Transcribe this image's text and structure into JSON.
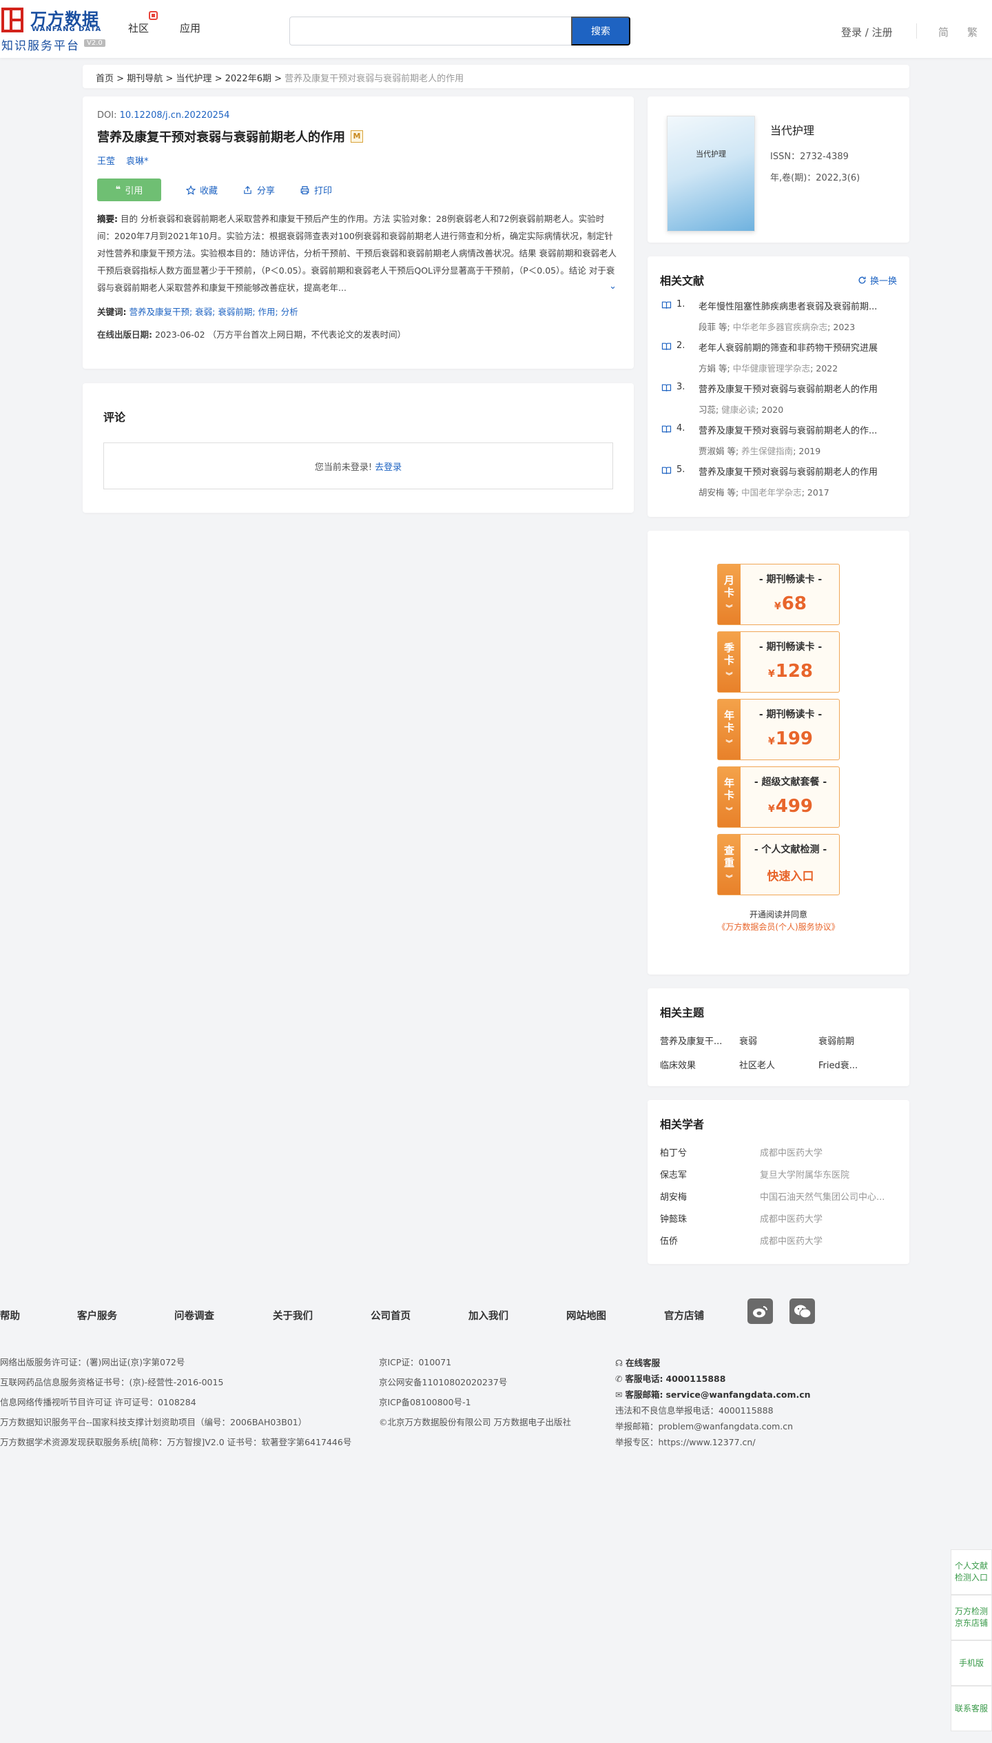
{
  "header": {
    "logo_cn": "万方数据",
    "logo_en": "WANFANG DATA",
    "logo_sub": "知识服务平台",
    "logo_ver": "V2.0",
    "nav": [
      "社区",
      "应用"
    ],
    "search_placeholder": "",
    "search_btn": "搜索",
    "login": "登录 / 注册",
    "lang_simplified": "简",
    "lang_traditional": "繁"
  },
  "breadcrumb": {
    "items": [
      "首页",
      "期刊导航",
      "当代护理",
      "2022年6期"
    ],
    "sep": ">",
    "current": "营养及康复干预对衰弱与衰弱前期老人的作用"
  },
  "article": {
    "doi_label": "DOI:",
    "doi": "10.12208/j.cn.20220254",
    "title": "营养及康复干预对衰弱与衰弱前期老人的作用",
    "m_badge": "M",
    "authors": [
      "王莹",
      "袁琳*"
    ],
    "actions": {
      "cite": "引用",
      "fav": "收藏",
      "share": "分享",
      "print": "打印"
    },
    "abstract_label": "摘要:",
    "abstract": "目的 分析衰弱和衰弱前期老人采取营养和康复干预后产生的作用。方法 实验对象：28例衰弱老人和72例衰弱前期老人。实验时间：2020年7月到2021年10月。实验方法：根据衰弱筛查表对100例衰弱和衰弱前期老人进行筛查和分析，确定实际病情状况，制定针对性营养和康复干预方法。实验根本目的：随访评估，分析干预前、干预后衰弱和衰弱前期老人病情改善状况。结果 衰弱前期和衰弱老人干预后衰弱指标人数方面显著少于干预前，（P＜0.05）。衰弱前期和衰弱老人干预后QOL评分显著高于干预前，（P＜0.05）。结论 对于衰弱与衰弱前期老人采取营养和康复干预能够改善症状，提高老年...",
    "kw_label": "关键词:",
    "keywords": "营养及康复干预; 衰弱; 衰弱前期; 作用; 分析",
    "pub_label": "在线出版日期:",
    "pub_date": "2023-06-02",
    "pub_note": "（万方平台首次上网日期，不代表论文的发表时间）"
  },
  "comment": {
    "title": "评论",
    "not_logged": "您当前未登录!",
    "go_login": "去登录"
  },
  "journal": {
    "cover_title": "当代护理",
    "name": "当代护理",
    "issn": "ISSN：2732-4389",
    "year": "年,卷(期)：2022,3(6)"
  },
  "related": {
    "title": "相关文献",
    "swap": "换一换",
    "items": [
      {
        "num": "1.",
        "title": "老年慢性阻塞性肺疾病患者衰弱及衰弱前期...",
        "authors": "段菲  等;",
        "journal": "中华老年多器官疾病杂志",
        "year": "2023"
      },
      {
        "num": "2.",
        "title": "老年人衰弱前期的筛查和非药物干预研究进展",
        "authors": "方娟  等;",
        "journal": "中华健康管理学杂志",
        "year": "2022"
      },
      {
        "num": "3.",
        "title": "营养及康复干预对衰弱与衰弱前期老人的作用",
        "authors": "习蕊;",
        "journal": "健康必读",
        "year": "2020"
      },
      {
        "num": "4.",
        "title": "营养及康复干预对衰弱与衰弱前期老人的作...",
        "authors": "贾淑娟  等;",
        "journal": "养生保健指南",
        "year": "2019"
      },
      {
        "num": "5.",
        "title": "营养及康复干预对衰弱与衰弱前期老人的作用",
        "authors": "胡安梅  等;",
        "journal": "中国老年学杂志",
        "year": "2017"
      }
    ]
  },
  "vip": {
    "cards": [
      {
        "side": [
          "月",
          "卡"
        ],
        "name": "- 期刊畅读卡 -",
        "currency": "¥",
        "price": "68"
      },
      {
        "side": [
          "季",
          "卡"
        ],
        "name": "- 期刊畅读卡 -",
        "currency": "¥",
        "price": "128"
      },
      {
        "side": [
          "年",
          "卡"
        ],
        "name": "- 期刊畅读卡 -",
        "currency": "¥",
        "price": "199"
      },
      {
        "side": [
          "年",
          "卡"
        ],
        "name": "- 超级文献套餐 -",
        "currency": "¥",
        "price": "499"
      }
    ],
    "check": {
      "side": [
        "查",
        "重"
      ],
      "name": "- 个人文献检测 -",
      "link": "快速入口"
    },
    "agree_line1": "开通阅读并同意",
    "agree_line2": "《万方数据会员(个人)服务协议》"
  },
  "topics": {
    "title": "相关主题",
    "items": [
      "营养及康复干...",
      "衰弱",
      "衰弱前期",
      "临床效果",
      "社区老人",
      "Fried衰..."
    ]
  },
  "scholars": {
    "title": "相关学者",
    "items": [
      {
        "name": "柏丁兮",
        "aff": "成都中医药大学"
      },
      {
        "name": "保志军",
        "aff": "复旦大学附属华东医院"
      },
      {
        "name": "胡安梅",
        "aff": "中国石油天然气集团公司中心..."
      },
      {
        "name": "钟懿珠",
        "aff": "成都中医药大学"
      },
      {
        "name": "伍侨",
        "aff": "成都中医药大学"
      }
    ]
  },
  "footer": {
    "links": [
      "帮助",
      "客户服务",
      "问卷调查",
      "关于我们",
      "公司首页",
      "加入我们",
      "网站地图",
      "官方店铺"
    ],
    "col1": [
      "网络出版服务许可证：(署)网出证(京)字第072号",
      "互联网药品信息服务资格证书号：(京)-经营性-2016-0015",
      "信息网络传播视听节目许可证 许可证号：0108284",
      "万方数据知识服务平台--国家科技支撑计划资助项目（编号：2006BAH03B01）",
      "万方数据学术资源发现获取服务系统[简称：万方智搜]V2.0 证书号：软著登字第6417446号"
    ],
    "col2": [
      "京ICP证：010071",
      "京公网安备11010802020237号",
      "京ICP备08100800号-1",
      "©北京万方数据股份有限公司 万方数据电子出版社"
    ],
    "online_service": "在线客服",
    "phone_label": "客服电话:",
    "phone": "4000115888",
    "email_label": "客服邮箱:",
    "email": "service@wanfangdata.com.cn",
    "report_phone": "违法和不良信息举报电话：4000115888",
    "report_email": "举报邮箱：problem@wanfangdata.com.cn",
    "report_zone": "举报专区：https://www.12377.cn/"
  },
  "floaters": [
    "个人文献检测入口",
    "万方检测京东店铺",
    "手机版",
    "联系客服"
  ],
  "colors": {
    "brand_blue": "#1e63c2",
    "cite_green": "#6fbf73",
    "vip_orange": "#e8812a",
    "logo_red": "#d3231b"
  }
}
